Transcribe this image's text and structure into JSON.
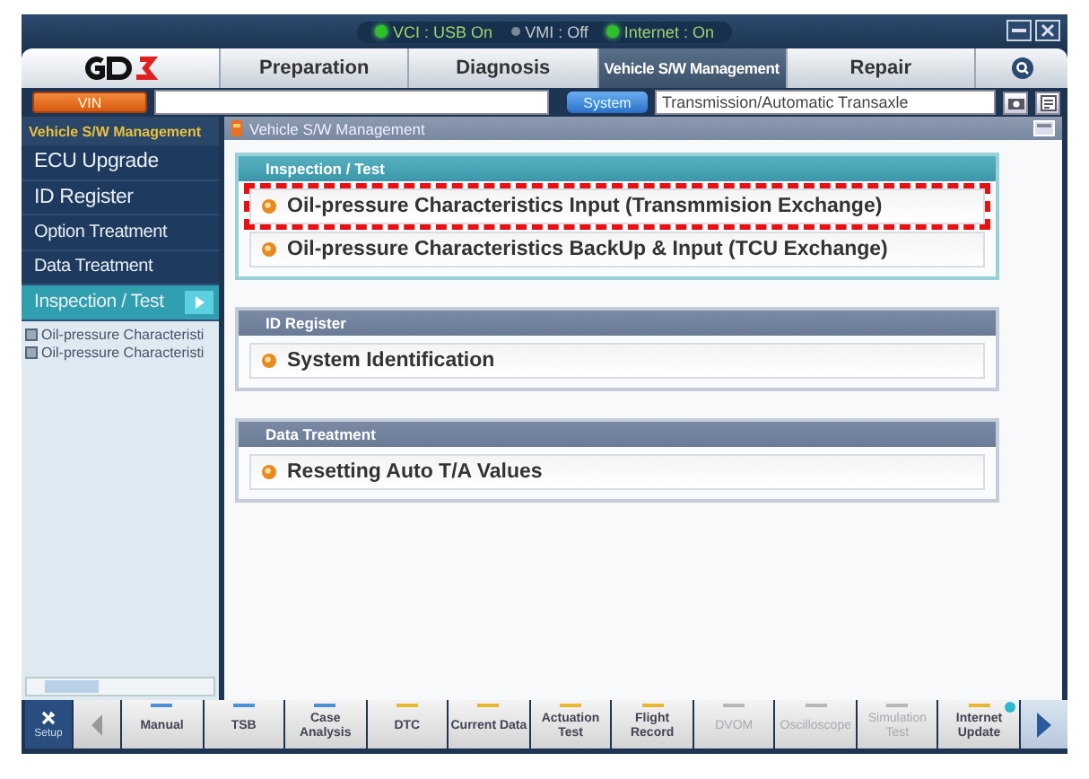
{
  "status": [
    {
      "label": "VCI : USB On",
      "on": true
    },
    {
      "label": "VMI : Off",
      "on": false
    },
    {
      "label": "Internet : On",
      "on": true
    }
  ],
  "tabs": [
    {
      "label": "Preparation",
      "selected": false
    },
    {
      "label": "Diagnosis",
      "selected": false
    },
    {
      "label": "Vehicle S/W Management",
      "selected": true
    },
    {
      "label": "Repair",
      "selected": false
    }
  ],
  "toolbar": {
    "vin_button": "VIN",
    "system_button": "System",
    "system_field": "Transmission/Automatic Transaxle"
  },
  "sidebar": {
    "title": "Vehicle S/W Management",
    "items": [
      {
        "label": "ECU Upgrade",
        "selected": false
      },
      {
        "label": "ID Register",
        "selected": false
      },
      {
        "label": "Option Treatment",
        "selected": false
      },
      {
        "label": "Data Treatment",
        "selected": false
      },
      {
        "label": "Inspection / Test",
        "selected": true
      }
    ],
    "history": [
      "Oil-pressure  Characteristi",
      "Oil-pressure  Characteristi"
    ]
  },
  "main": {
    "title": "Vehicle S/W Management",
    "groups": [
      {
        "title": "Inspection / Test",
        "selected": true,
        "items": [
          {
            "label": "Oil-pressure Characteristics Input (Transmmision Exchange)",
            "highlighted": true
          },
          {
            "label": "Oil-pressure Characteristics BackUp & Input (TCU Exchange)",
            "highlighted": false
          }
        ]
      },
      {
        "title": "ID Register",
        "selected": false,
        "items": [
          {
            "label": "System Identification",
            "highlighted": false
          }
        ]
      },
      {
        "title": "Data Treatment",
        "selected": false,
        "items": [
          {
            "label": "Resetting Auto T/A Values",
            "highlighted": false
          }
        ]
      }
    ]
  },
  "bottom_bar": {
    "setup": "Setup",
    "tools": [
      {
        "label": "Manual",
        "disabled": false,
        "color": "#4a90d9",
        "notification": false
      },
      {
        "label": "TSB",
        "disabled": false,
        "color": "#4a90d9",
        "notification": false
      },
      {
        "label": "Case Analysis",
        "disabled": false,
        "color": "#4a90d9",
        "notification": false
      },
      {
        "label": "DTC",
        "disabled": false,
        "color": "#e8b830",
        "notification": false
      },
      {
        "label": "Current Data",
        "disabled": false,
        "color": "#e8b830",
        "notification": false
      },
      {
        "label": "Actuation Test",
        "disabled": false,
        "color": "#e8b830",
        "notification": false
      },
      {
        "label": "Flight Record",
        "disabled": false,
        "color": "#e8b830",
        "notification": false
      },
      {
        "label": "DVOM",
        "disabled": true,
        "color": "#b8b8b8",
        "notification": false
      },
      {
        "label": "Oscilloscope",
        "disabled": true,
        "color": "#b8b8b8",
        "notification": false
      },
      {
        "label": "Simulation Test",
        "disabled": true,
        "color": "#b8b8b8",
        "notification": false
      },
      {
        "label": "Internet Update",
        "disabled": false,
        "color": "#e8b830",
        "notification": true
      }
    ]
  }
}
